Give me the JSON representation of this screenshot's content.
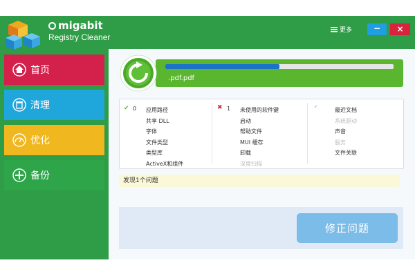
{
  "app": {
    "brand": "migabit",
    "subtitle": "Registry Cleaner",
    "more_label": "更多",
    "minimize_label": "−",
    "close_label": "×"
  },
  "sidebar": {
    "items": [
      {
        "label": "首页"
      },
      {
        "label": "清理"
      },
      {
        "label": "优化"
      },
      {
        "label": "备份"
      }
    ]
  },
  "scan": {
    "current_file": ".pdf.pdf",
    "progress_percent": 50
  },
  "categories": {
    "col1_count": "0",
    "col1": [
      "应用路径",
      "共享 DLL",
      "字体",
      "文件类型",
      "类型库",
      "ActiveX和组件"
    ],
    "col2_count": "1",
    "col2": [
      "未使用的软件键",
      "启动",
      "帮助文件",
      "MUI 缓存",
      "卸载",
      "深度扫描"
    ],
    "col3": [
      "最近文档",
      "系统驱动",
      "声音",
      "服务",
      "文件关联"
    ]
  },
  "status": {
    "found": "发现1个问题"
  },
  "action": {
    "label": "修正问题"
  },
  "colors": {
    "window_green": "#2f9c47",
    "home_red": "#d4214c",
    "clean_blue": "#1fa7dc",
    "optimize_yellow": "#f0b71f",
    "progress_green": "#5ab52f"
  }
}
